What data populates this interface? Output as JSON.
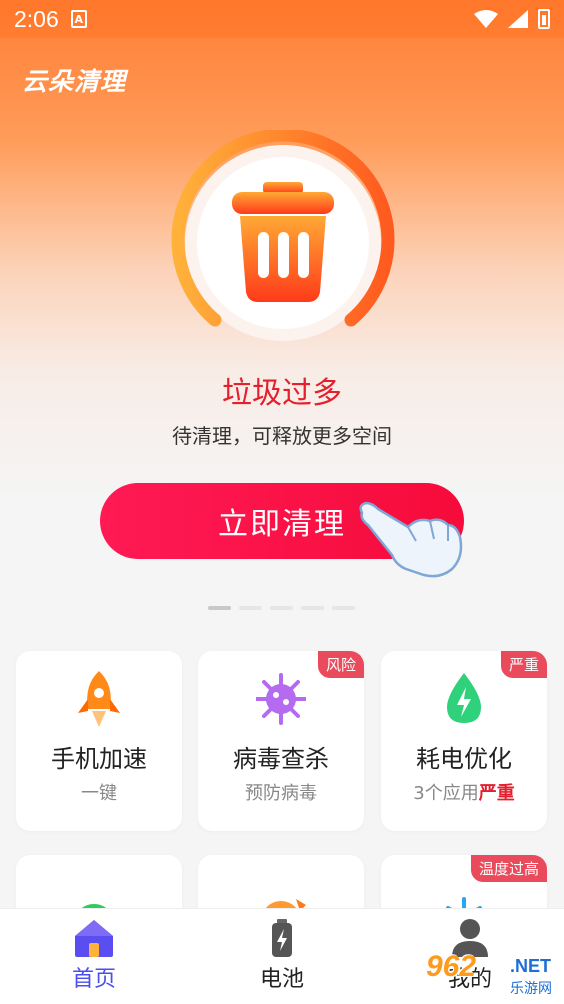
{
  "status_bar": {
    "time": "2:06",
    "notification_glyph": "A"
  },
  "app": {
    "title": "云朵清理"
  },
  "hero": {
    "status_title": "垃圾过多",
    "status_subtitle": "待清理，可释放更多空间",
    "clean_button": "立即清理",
    "icon": "trash-can-icon"
  },
  "carousel": {
    "page_count": 5,
    "active_index": 0
  },
  "features": [
    {
      "name": "手机加速",
      "desc": "一键",
      "icon": "rocket-icon",
      "badge": ""
    },
    {
      "name": "病毒查杀",
      "desc": "预防病毒",
      "icon": "virus-icon",
      "badge": "风险"
    },
    {
      "name": "耗电优化",
      "desc_prefix": "3个应用",
      "desc_highlight": "严重",
      "icon": "battery-drop-icon",
      "badge": "严重"
    }
  ],
  "features_row2": [
    {
      "icon": "wechat-icon",
      "badge": ""
    },
    {
      "icon": "game-icon",
      "badge": ""
    },
    {
      "icon": "snowflake-icon",
      "badge": "温度过高"
    }
  ],
  "tabbar": {
    "tabs": [
      {
        "label": "首页",
        "icon": "home-icon",
        "active": true
      },
      {
        "label": "电池",
        "icon": "battery-icon",
        "active": false
      },
      {
        "label": "我的",
        "icon": "user-icon",
        "active": false
      }
    ]
  },
  "watermark": {
    "digits": "962",
    "domain": ".NET",
    "cn": "乐游网"
  },
  "colors": {
    "accent_red": "#e5202e",
    "button_red": "#ff1a55",
    "tab_active": "#4a4ef0",
    "badge": "#e94b5c"
  }
}
